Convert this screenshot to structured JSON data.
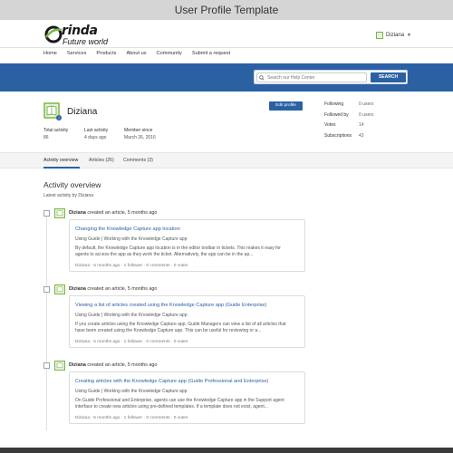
{
  "window": {
    "title": "User Profile Template"
  },
  "brand": {
    "name": "rinda",
    "tagline": "Future world",
    "accent": "#7ab648"
  },
  "header": {
    "user_name": "Diziana"
  },
  "nav": [
    "Home",
    "Services",
    "Products",
    "About us",
    "Community",
    "Submit a request"
  ],
  "search": {
    "placeholder": "Search our Help Center",
    "button_label": "SEARCH"
  },
  "colors": {
    "primary": "#2b61a3",
    "link": "#2b61a3"
  },
  "profile": {
    "name": "Diziana",
    "edit_label": "Edit profile",
    "stats": [
      {
        "label": "Total activity",
        "value": "86"
      },
      {
        "label": "Last activity",
        "value": "4 days ago"
      },
      {
        "label": "Member since",
        "value": "March 26, 2016"
      }
    ],
    "side_stats": [
      {
        "label": "Following",
        "value": "0 users"
      },
      {
        "label": "Followed by",
        "value": "0 users"
      },
      {
        "label": "Votes",
        "value": "14"
      },
      {
        "label": "Subscriptions",
        "value": "43"
      }
    ]
  },
  "tabs": [
    "Activity overview",
    "Articles (26)",
    "Comments (3)"
  ],
  "activity": {
    "title": "Activity overview",
    "subtitle": "Latest activity by Diziana",
    "items": [
      {
        "user": "Diziana",
        "action": "created an article, 5 months ago",
        "card": {
          "title": "Changing the Knowledge Capture app location",
          "crumbs": "Using Guide   |   Working with the Knowledge Capture app",
          "text": "By default, the Knowledge Capture app location is in the editor toolbar in tickets. This makes it easy for agents to access the app as they work the ticket. Alternatively, the app can be in the ap...",
          "meta": "Diziana  ·  5 months ago  ·  1 follower  ·  0 comments  ·  0 votes"
        }
      },
      {
        "user": "Diziana",
        "action": "created an article, 5 months ago",
        "card": {
          "title": "Viewing a list of articles created using the Knowledge Capture app (Guide Enterprise)",
          "crumbs": "Using Guide   |   Working with the Knowledge Capture app",
          "text": "If you create articles using the Knowledge Capture app, Guide Managers can view a list of all articles that have been created using the Knowledge Capture app. This can be useful for reviewing or a...",
          "meta": "Diziana  ·  5 months ago  ·  1 follower  ·  0 comments  ·  0 votes"
        }
      },
      {
        "user": "Diziana",
        "action": "created an article, 5 months ago",
        "card": {
          "title": "Creating articles with the Knowledge Capture app (Guide Professional and Enterprise)",
          "crumbs": "Using Guide   |   Working with the Knowledge Capture app",
          "text": "On Guide Professional and Enterprise, agents can use the Knowledge Capture app in the Support agent interface to create new articles using pre-defined templates. If a template does not exist, agent...",
          "meta": "Diziana  ·  5 months ago  ·  1 follower  ·  0 comments  ·  0 votes"
        }
      }
    ]
  }
}
